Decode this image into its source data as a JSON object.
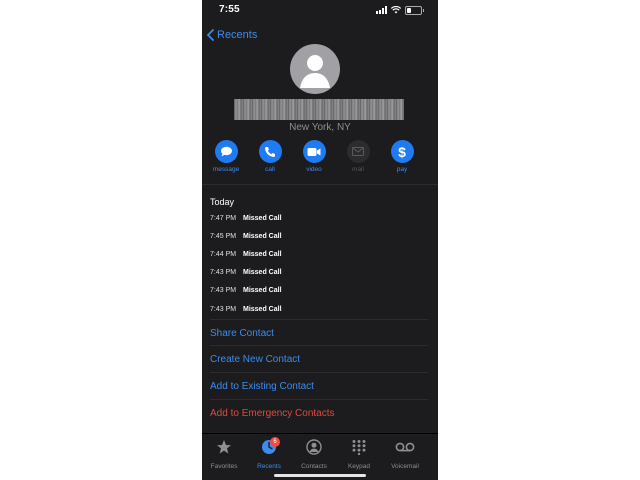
{
  "status_bar": {
    "time": "7:55"
  },
  "nav": {
    "back_label": "Recents"
  },
  "contact": {
    "location": "New York, NY"
  },
  "actions": [
    {
      "label": "message",
      "icon": "message-icon",
      "enabled": true
    },
    {
      "label": "call",
      "icon": "phone-icon",
      "enabled": true
    },
    {
      "label": "video",
      "icon": "video-icon",
      "enabled": true
    },
    {
      "label": "mail",
      "icon": "mail-icon",
      "enabled": false
    },
    {
      "label": "pay",
      "icon": "dollar-icon",
      "enabled": true
    }
  ],
  "history": {
    "heading": "Today",
    "calls": [
      {
        "time": "7:47 PM",
        "status": "Missed Call"
      },
      {
        "time": "7:45 PM",
        "status": "Missed Call"
      },
      {
        "time": "7:44 PM",
        "status": "Missed Call"
      },
      {
        "time": "7:43 PM",
        "status": "Missed Call"
      },
      {
        "time": "7:43 PM",
        "status": "Missed Call"
      },
      {
        "time": "7:43 PM",
        "status": "Missed Call"
      }
    ]
  },
  "options": [
    {
      "label": "Share Contact"
    },
    {
      "label": "Create New Contact"
    },
    {
      "label": "Add to Existing Contact"
    },
    {
      "label": "Add to Emergency Contacts",
      "destructive": true
    }
  ],
  "tabs": [
    {
      "label": "Favorites",
      "icon": "star-icon"
    },
    {
      "label": "Recents",
      "icon": "clock-icon",
      "active": true,
      "badge": "6"
    },
    {
      "label": "Contacts",
      "icon": "person-circle-icon"
    },
    {
      "label": "Keypad",
      "icon": "keypad-icon"
    },
    {
      "label": "Voicemail",
      "icon": "voicemail-icon"
    }
  ],
  "colors": {
    "accent": "#1f7bf2",
    "link": "#3a8cf0",
    "destructive": "#e0493f",
    "background": "#1c1c1e",
    "badge": "#f04b3f"
  }
}
